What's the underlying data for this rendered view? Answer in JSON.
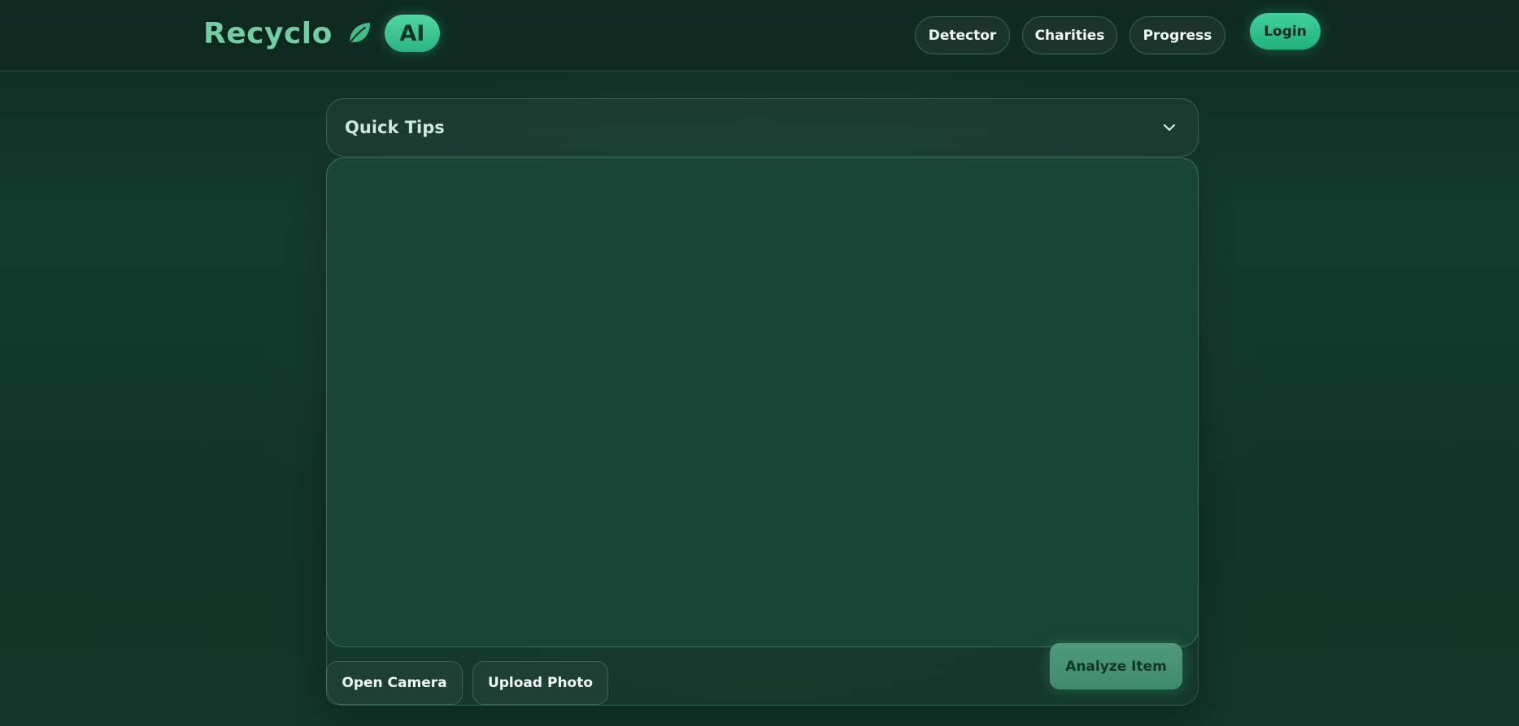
{
  "brand": {
    "name": "Recyclo",
    "logo_icon": "leaf-icon",
    "badge": "AI"
  },
  "nav": {
    "items": [
      {
        "label": "Detector"
      },
      {
        "label": "Charities"
      },
      {
        "label": "Progress"
      }
    ],
    "login_label": "Login"
  },
  "tips": {
    "title": "Quick Tips",
    "toggle_icon": "chevron-down-icon",
    "expanded": false
  },
  "actions": {
    "open_camera_label": "Open Camera",
    "upload_photo_label": "Upload Photo",
    "analyze_label": "Analyze Item"
  },
  "colors": {
    "background": "#123629",
    "accent": "#3fd29c",
    "brand_text": "#6fcfa4",
    "analyze_button": "#4f9a7d",
    "preview_fill": "#1a4435"
  }
}
